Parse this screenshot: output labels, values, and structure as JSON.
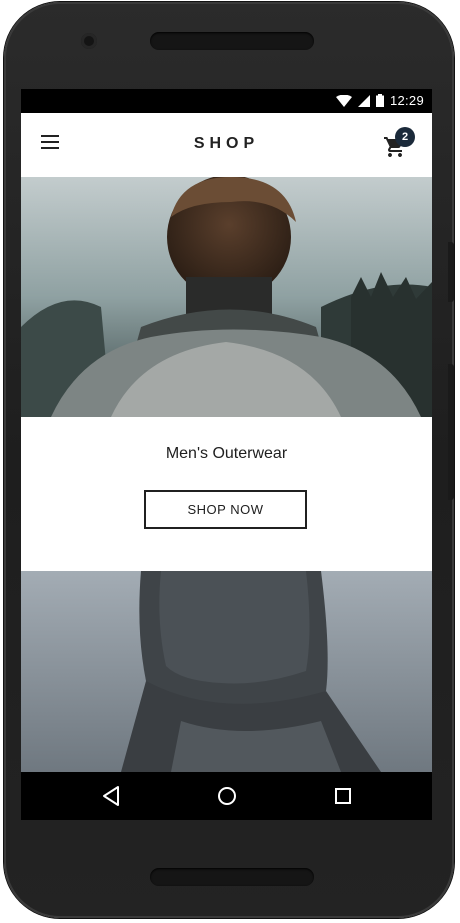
{
  "status_bar": {
    "time": "12:29",
    "icons": [
      "wifi-icon",
      "signal-icon",
      "battery-icon"
    ]
  },
  "app_bar": {
    "title": "SHOP",
    "menu_icon": "hamburger-menu-icon",
    "cart_icon": "shopping-cart-icon",
    "cart_count": "2"
  },
  "categories": [
    {
      "title": "Men's Outerwear",
      "button_label": "SHOP NOW",
      "image": "man-in-grey-sweater-photo"
    },
    {
      "image": "person-in-knit-hood-photo"
    }
  ],
  "nav_bar": {
    "buttons": [
      "back-icon",
      "home-icon",
      "recents-icon"
    ]
  },
  "colors": {
    "badge": "#1b2a3a",
    "text": "#202020",
    "statusbar": "#000000"
  }
}
